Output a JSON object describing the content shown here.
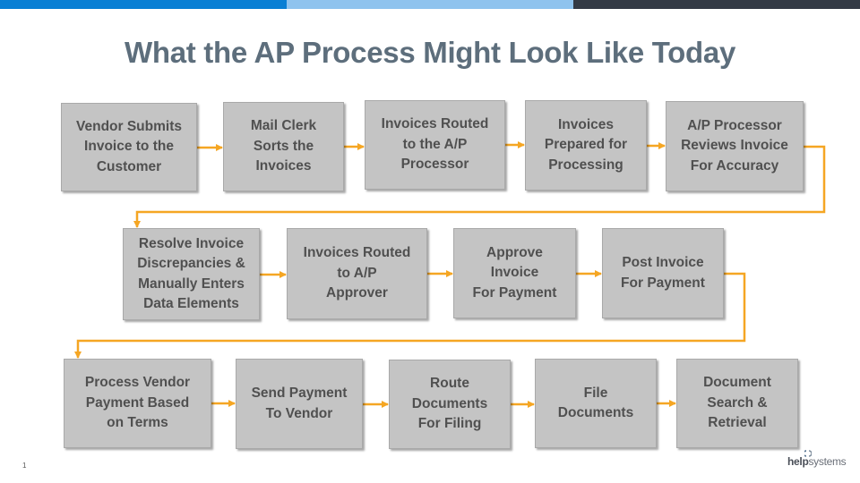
{
  "slide": {
    "title": "What the AP Process Might Look Like Today",
    "page_number": "1",
    "logo": {
      "part1": "help",
      "part2": "systems"
    }
  },
  "colors": {
    "bar_left": "#0a7fd4",
    "bar_middle": "#8fc3ee",
    "bar_right": "#333a45",
    "box_fill": "#c4c4c4",
    "box_text": "#505050",
    "connector": "#f5a623",
    "title": "#5d6e7c"
  },
  "flow": {
    "rows": [
      {
        "steps": [
          {
            "id": "s1",
            "label": "Vendor Submits\nInvoice to the\nCustomer"
          },
          {
            "id": "s2",
            "label": "Mail Clerk\nSorts the\nInvoices"
          },
          {
            "id": "s3",
            "label": "Invoices Routed\nto the A/P\nProcessor"
          },
          {
            "id": "s4",
            "label": "Invoices\nPrepared for\nProcessing"
          },
          {
            "id": "s5",
            "label": "A/P Processor\nReviews Invoice\nFor Accuracy"
          }
        ]
      },
      {
        "steps": [
          {
            "id": "s6",
            "label": "Resolve Invoice\nDiscrepancies &\nManually Enters\nData Elements"
          },
          {
            "id": "s7",
            "label": "Invoices Routed\nto A/P\nApprover"
          },
          {
            "id": "s8",
            "label": "Approve\nInvoice\nFor Payment"
          },
          {
            "id": "s9",
            "label": "Post Invoice\nFor Payment"
          }
        ]
      },
      {
        "steps": [
          {
            "id": "s10",
            "label": "Process Vendor\nPayment Based\non Terms"
          },
          {
            "id": "s11",
            "label": "Send Payment\nTo Vendor"
          },
          {
            "id": "s12",
            "label": "Route\nDocuments\nFor Filing"
          },
          {
            "id": "s13",
            "label": "File\nDocuments"
          },
          {
            "id": "s14",
            "label": "Document\nSearch &\nRetrieval"
          }
        ]
      }
    ],
    "edges": [
      [
        "s1",
        "s2"
      ],
      [
        "s2",
        "s3"
      ],
      [
        "s3",
        "s4"
      ],
      [
        "s4",
        "s5"
      ],
      [
        "s5",
        "s6"
      ],
      [
        "s6",
        "s7"
      ],
      [
        "s7",
        "s8"
      ],
      [
        "s8",
        "s9"
      ],
      [
        "s9",
        "s10"
      ],
      [
        "s10",
        "s11"
      ],
      [
        "s11",
        "s12"
      ],
      [
        "s12",
        "s13"
      ],
      [
        "s13",
        "s14"
      ]
    ]
  }
}
